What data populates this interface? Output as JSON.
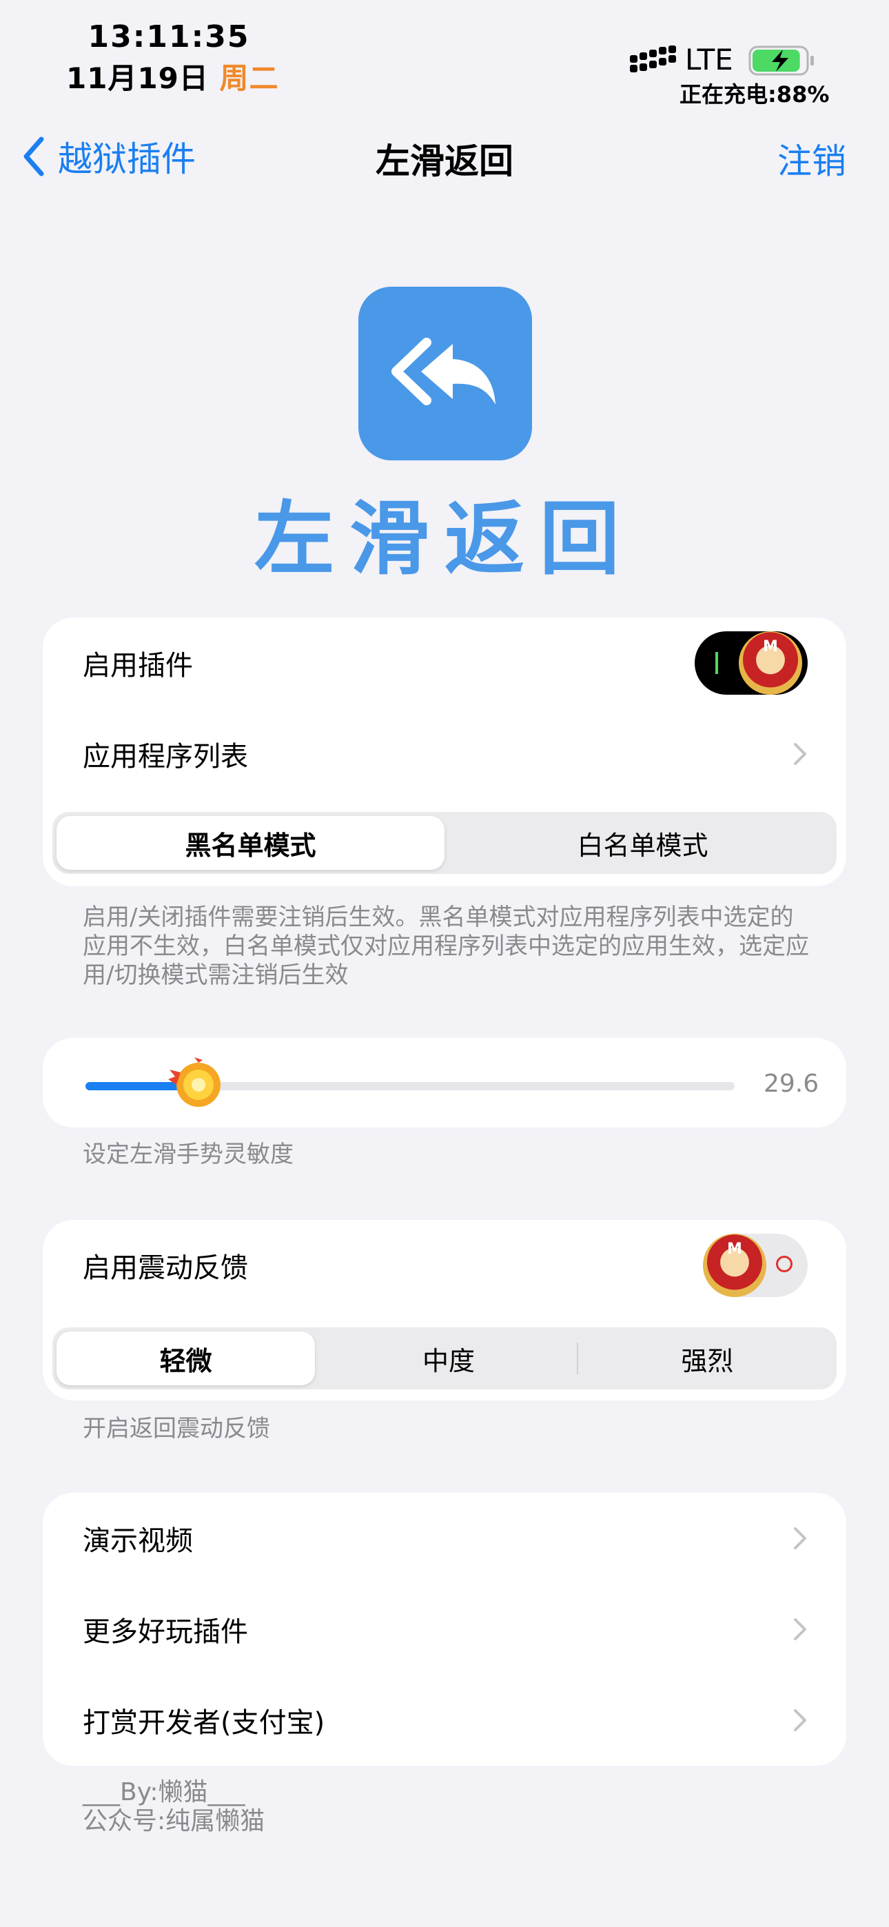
{
  "status_bar": {
    "time": "13:11:35",
    "date": "11月19日",
    "weekday": "周二",
    "network": "LTE",
    "charging_text": "正在充电:88%",
    "battery_level": 0.88
  },
  "nav": {
    "back_label": "越狱插件",
    "title": "左滑返回",
    "right_label": "注销"
  },
  "hero": {
    "title": "左滑返回"
  },
  "plugin_card": {
    "enable_label": "启用插件",
    "enable_on": true,
    "app_list_label": "应用程序列表",
    "modes": [
      "黑名单模式",
      "白名单模式"
    ],
    "selected_mode": 0
  },
  "plugin_note": "启用/关闭插件需要注销后生效。黑名单模式对应用程序列表中选定的应用不生效，白名单模式仅对应用程序列表中选定的应用生效，选定应用/切换模式需注销后生效",
  "sensitivity": {
    "value_text": "29.6",
    "level": 0.17
  },
  "sensitivity_note": "设定左滑手势灵敏度",
  "haptic_card": {
    "enable_label": "启用震动反馈",
    "enable_on": false,
    "levels": [
      "轻微",
      "中度",
      "强烈"
    ],
    "selected_level": 0
  },
  "haptic_note": "开启返回震动反馈",
  "links_card": {
    "items": [
      "演示视频",
      "更多好玩插件",
      "打赏开发者(支付宝)"
    ]
  },
  "footer": {
    "line1": "___By:懒猫___",
    "line2": "公众号:纯属懒猫"
  },
  "colors": {
    "accent": "#1a7ff0",
    "hero_blue": "#4a98e8",
    "weekday_orange": "#f0892b",
    "battery_green": "#4cd964"
  }
}
